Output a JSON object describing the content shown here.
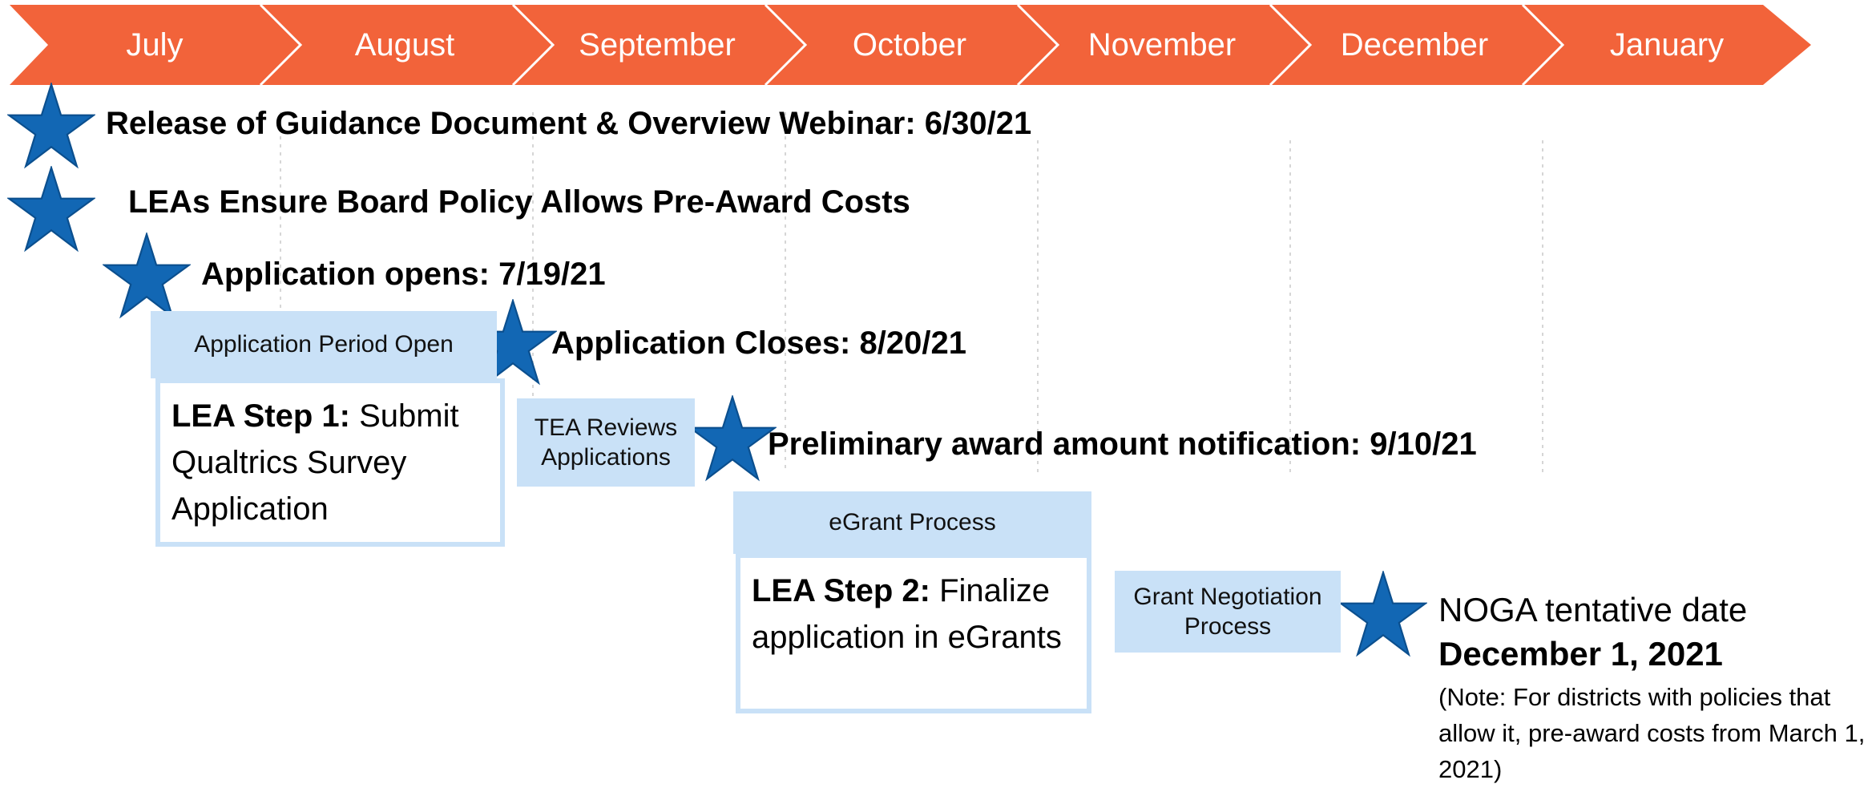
{
  "colors": {
    "header": "#f2633a",
    "star": "#1267b4",
    "band": "#c9e1f7"
  },
  "months": [
    "July",
    "August",
    "September",
    "October",
    "November",
    "December",
    "January"
  ],
  "milestones": {
    "release": "Release of Guidance Document & Overview Webinar: 6/30/21",
    "board_policy": "LEAs Ensure Board Policy Allows Pre-Award Costs",
    "app_opens": "Application opens: 7/19/21",
    "app_closes": "Application Closes:  8/20/21",
    "preliminary": "Preliminary award amount notification: 9/10/21"
  },
  "bands": {
    "app_period": "Application Period Open",
    "tea_review_1": "TEA Reviews",
    "tea_review_2": "Applications",
    "egrant": "eGrant Process",
    "negotiation_1": "Grant Negotiation",
    "negotiation_2": "Process"
  },
  "steps": {
    "step1_bold": "LEA Step 1:",
    "step1_text": " Submit Qualtrics Survey Application",
    "step2_bold": "LEA Step 2:",
    "step2_text": " Finalize application in eGrants"
  },
  "noga": {
    "line1": "NOGA tentative date",
    "line2": "December 1, 2021",
    "note": "(Note: For districts with policies that allow it, pre-award costs from March 1, 2021)"
  }
}
